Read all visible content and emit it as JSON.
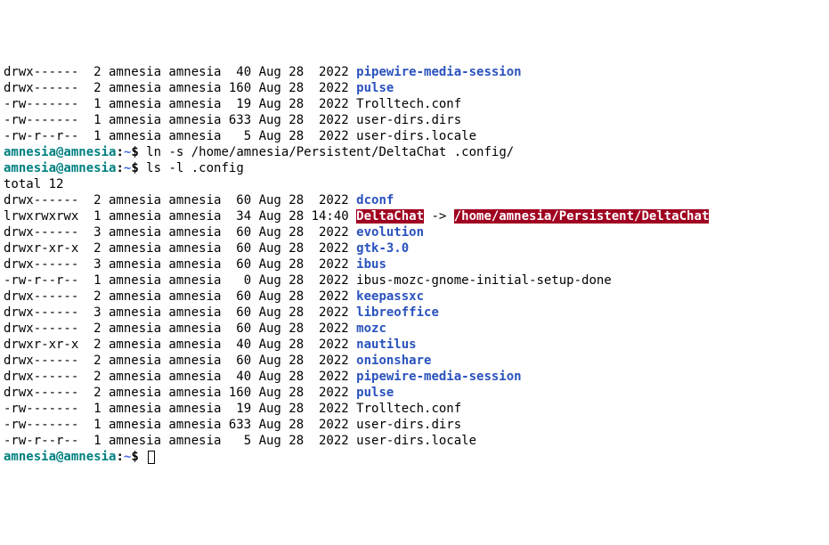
{
  "pre_rows": [
    {
      "perms": "drwx------",
      "links": "2",
      "owner": "amnesia",
      "group": "amnesia",
      "size": "40",
      "date": "Aug 28",
      "time": "2022",
      "name": "pipewire-media-session",
      "type": "dir"
    },
    {
      "perms": "drwx------",
      "links": "2",
      "owner": "amnesia",
      "group": "amnesia",
      "size": "160",
      "date": "Aug 28",
      "time": "2022",
      "name": "pulse",
      "type": "dir"
    },
    {
      "perms": "-rw-------",
      "links": "1",
      "owner": "amnesia",
      "group": "amnesia",
      "size": "19",
      "date": "Aug 28",
      "time": "2022",
      "name": "Trolltech.conf",
      "type": "file"
    },
    {
      "perms": "-rw-------",
      "links": "1",
      "owner": "amnesia",
      "group": "amnesia",
      "size": "633",
      "date": "Aug 28",
      "time": "2022",
      "name": "user-dirs.dirs",
      "type": "file"
    },
    {
      "perms": "-rw-r--r--",
      "links": "1",
      "owner": "amnesia",
      "group": "amnesia",
      "size": "5",
      "date": "Aug 28",
      "time": "2022",
      "name": "user-dirs.locale",
      "type": "file"
    }
  ],
  "cmd1": {
    "user": "amnesia@amnesia",
    "colon": ":",
    "path": "~",
    "sigil": "$ ",
    "cmd": "ln -s /home/amnesia/Persistent/DeltaChat .config/"
  },
  "cmd2": {
    "user": "amnesia@amnesia",
    "colon": ":",
    "path": "~",
    "sigil": "$ ",
    "cmd": "ls -l .config"
  },
  "total_label": "total 12",
  "rows": [
    {
      "perms": "drwx------",
      "links": "2",
      "owner": "amnesia",
      "group": "amnesia",
      "size": "60",
      "date": "Aug 28",
      "time": "2022",
      "name": "dconf",
      "type": "dir"
    },
    {
      "perms": "lrwxrwxrwx",
      "links": "1",
      "owner": "amnesia",
      "group": "amnesia",
      "size": "34",
      "date": "Aug 28",
      "time": "14:40",
      "name": "DeltaChat",
      "type": "symlink",
      "arrow": " -> ",
      "target": "/home/amnesia/Persistent/DeltaChat"
    },
    {
      "perms": "drwx------",
      "links": "3",
      "owner": "amnesia",
      "group": "amnesia",
      "size": "60",
      "date": "Aug 28",
      "time": "2022",
      "name": "evolution",
      "type": "dir"
    },
    {
      "perms": "drwxr-xr-x",
      "links": "2",
      "owner": "amnesia",
      "group": "amnesia",
      "size": "60",
      "date": "Aug 28",
      "time": "2022",
      "name": "gtk-3.0",
      "type": "dir"
    },
    {
      "perms": "drwx------",
      "links": "3",
      "owner": "amnesia",
      "group": "amnesia",
      "size": "60",
      "date": "Aug 28",
      "time": "2022",
      "name": "ibus",
      "type": "dir"
    },
    {
      "perms": "-rw-r--r--",
      "links": "1",
      "owner": "amnesia",
      "group": "amnesia",
      "size": "0",
      "date": "Aug 28",
      "time": "2022",
      "name": "ibus-mozc-gnome-initial-setup-done",
      "type": "file"
    },
    {
      "perms": "drwx------",
      "links": "2",
      "owner": "amnesia",
      "group": "amnesia",
      "size": "60",
      "date": "Aug 28",
      "time": "2022",
      "name": "keepassxc",
      "type": "dir"
    },
    {
      "perms": "drwx------",
      "links": "3",
      "owner": "amnesia",
      "group": "amnesia",
      "size": "60",
      "date": "Aug 28",
      "time": "2022",
      "name": "libreoffice",
      "type": "dir"
    },
    {
      "perms": "drwx------",
      "links": "2",
      "owner": "amnesia",
      "group": "amnesia",
      "size": "60",
      "date": "Aug 28",
      "time": "2022",
      "name": "mozc",
      "type": "dir"
    },
    {
      "perms": "drwxr-xr-x",
      "links": "2",
      "owner": "amnesia",
      "group": "amnesia",
      "size": "40",
      "date": "Aug 28",
      "time": "2022",
      "name": "nautilus",
      "type": "dir"
    },
    {
      "perms": "drwx------",
      "links": "2",
      "owner": "amnesia",
      "group": "amnesia",
      "size": "60",
      "date": "Aug 28",
      "time": "2022",
      "name": "onionshare",
      "type": "dir"
    },
    {
      "perms": "drwx------",
      "links": "2",
      "owner": "amnesia",
      "group": "amnesia",
      "size": "40",
      "date": "Aug 28",
      "time": "2022",
      "name": "pipewire-media-session",
      "type": "dir"
    },
    {
      "perms": "drwx------",
      "links": "2",
      "owner": "amnesia",
      "group": "amnesia",
      "size": "160",
      "date": "Aug 28",
      "time": "2022",
      "name": "pulse",
      "type": "dir"
    },
    {
      "perms": "-rw-------",
      "links": "1",
      "owner": "amnesia",
      "group": "amnesia",
      "size": "19",
      "date": "Aug 28",
      "time": "2022",
      "name": "Trolltech.conf",
      "type": "file"
    },
    {
      "perms": "-rw-------",
      "links": "1",
      "owner": "amnesia",
      "group": "amnesia",
      "size": "633",
      "date": "Aug 28",
      "time": "2022",
      "name": "user-dirs.dirs",
      "type": "file"
    },
    {
      "perms": "-rw-r--r--",
      "links": "1",
      "owner": "amnesia",
      "group": "amnesia",
      "size": "5",
      "date": "Aug 28",
      "time": "2022",
      "name": "user-dirs.locale",
      "type": "file"
    }
  ],
  "cmd3": {
    "user": "amnesia@amnesia",
    "colon": ":",
    "path": "~",
    "sigil": "$ "
  }
}
